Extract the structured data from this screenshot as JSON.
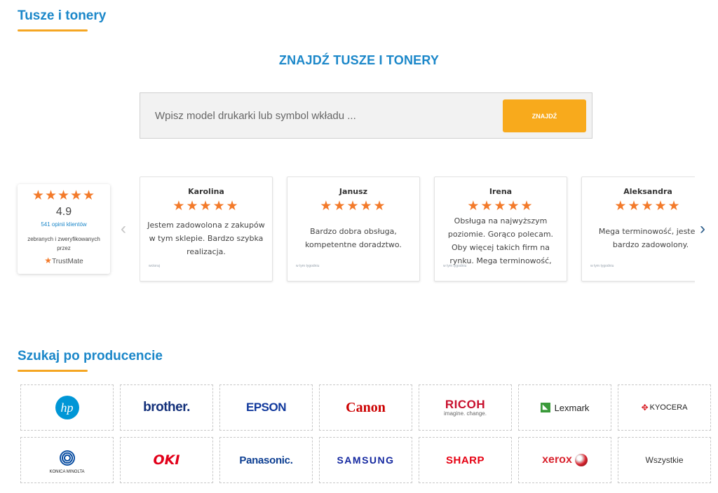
{
  "page": {
    "section1_title": "Tusze i tonery",
    "section2_title": "Szukaj po producencie"
  },
  "search": {
    "heading": "ZNAJDŹ TUSZE I TONERY",
    "placeholder": "Wpisz model drukarki lub symbol wkładu ...",
    "button_label": "ZNAJDŹ"
  },
  "trustmate": {
    "stars": "★★★★★",
    "rating": "4.9",
    "count": "541 opinii klientów",
    "description": "zebranych i zweryfikowanych przez",
    "logo_text": "TrustMate"
  },
  "carousel": {
    "prev_icon": "‹",
    "next_icon": "›"
  },
  "reviews": [
    {
      "name": "Karolina",
      "stars": "★★★★★",
      "text": "Jestem zadowolona z zakupów w tym sklepie. Bardzo szybka realizacja.",
      "source": "wctoraj"
    },
    {
      "name": "Janusz",
      "stars": "★★★★★",
      "text": "Bardzo dobra obsługa, kompetentne doradztwo.",
      "source": "w tym tygodniu"
    },
    {
      "name": "Irena",
      "stars": "★★★★★",
      "text": "Obsługa na najwyższym poziomie. Gorąco polecam. Oby więcej takich firm na rynku. Mega terminowość,",
      "source": "w tym tygodniu"
    },
    {
      "name": "Aleksandra",
      "stars": "★★★★★",
      "text": "Mega terminowość, jestem bardzo zadowolony.",
      "source": "w tym tygodniu"
    }
  ],
  "brands": [
    {
      "name": "hp",
      "label": "hp",
      "color": "#0096d6"
    },
    {
      "name": "brother",
      "label": "brother.",
      "color": "#13307a"
    },
    {
      "name": "epson",
      "label": "EPSON",
      "color": "#10389c"
    },
    {
      "name": "canon",
      "label": "Canon",
      "color": "#cc0000"
    },
    {
      "name": "ricoh",
      "label": "RICOH",
      "sublabel": "imagine. change.",
      "color": "#c8102e"
    },
    {
      "name": "lexmark",
      "label": "Lexmark",
      "color": "#222222"
    },
    {
      "name": "kyocera",
      "label": "KYOCERA",
      "color": "#222222"
    },
    {
      "name": "konica-minolta",
      "label": "KONICA MINOLTA",
      "color": "#222222"
    },
    {
      "name": "oki",
      "label": "OKI",
      "color": "#e2001a"
    },
    {
      "name": "panasonic",
      "label": "Panasonic.",
      "color": "#0b3d91"
    },
    {
      "name": "samsung",
      "label": "SAMSUNG",
      "color": "#1428a0"
    },
    {
      "name": "sharp",
      "label": "SHARP",
      "color": "#e60012"
    },
    {
      "name": "xerox",
      "label": "xerox",
      "color": "#d9232e"
    },
    {
      "name": "all",
      "label": "Wszystkie",
      "color": "#333333"
    }
  ]
}
